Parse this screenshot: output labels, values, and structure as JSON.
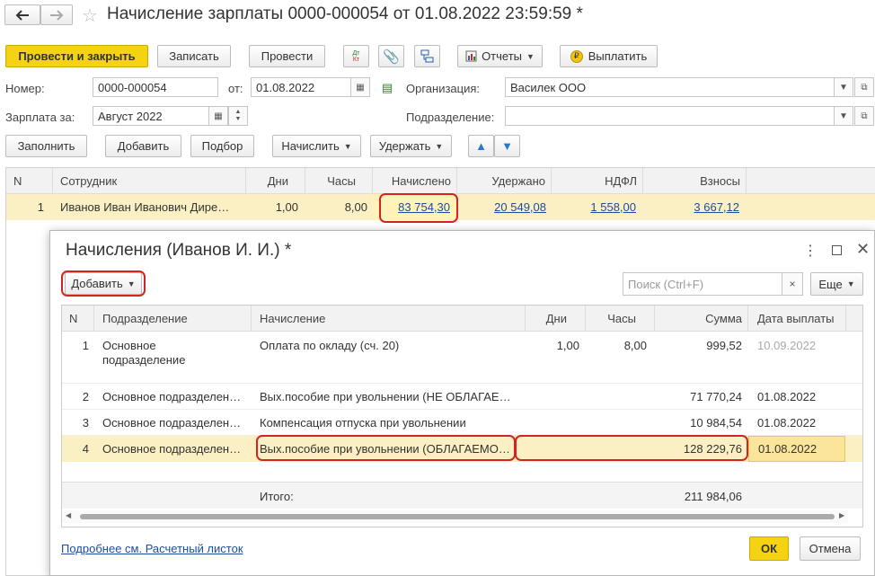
{
  "window": {
    "title": "Начисление зарплаты 0000-000054 от 01.08.2022 23:59:59 *"
  },
  "toolbar": {
    "post_close": "Провести и закрыть",
    "save": "Записать",
    "post": "Провести",
    "reports": "Отчеты",
    "pay": "Выплатить",
    "dtkt": "Дт Кт"
  },
  "header": {
    "number_label": "Номер:",
    "number": "0000-000054",
    "date_label": "от:",
    "date": "01.08.2022",
    "org_label": "Организация:",
    "org": "Василек ООО",
    "salary_for_label": "Зарплата за:",
    "salary_for": "Август 2022",
    "dept_label": "Подразделение:",
    "dept": ""
  },
  "actions": {
    "fill": "Заполнить",
    "add": "Добавить",
    "select": "Подбор",
    "accrue": "Начислить",
    "withhold": "Удержать"
  },
  "main_table": {
    "columns": [
      "N",
      "Сотрудник",
      "Дни",
      "Часы",
      "Начислено",
      "Удержано",
      "НДФЛ",
      "Взносы"
    ],
    "rows": [
      {
        "n": "1",
        "employee": "Иванов Иван Иванович Дире…",
        "days": "1,00",
        "hours": "8,00",
        "accrued": "83 754,30",
        "withheld": "20 549,08",
        "ndfl": "1 558,00",
        "contrib": "3 667,12"
      }
    ]
  },
  "dialog": {
    "title": "Начисления (Иванов И. И.) *",
    "add": "Добавить",
    "search_placeholder": "Поиск (Ctrl+F)",
    "more": "Еще",
    "columns": [
      "N",
      "Подразделение",
      "Начисление",
      "Дни",
      "Часы",
      "Сумма",
      "Дата выплаты"
    ],
    "rows": [
      {
        "n": "1",
        "dept": "Основное",
        "dept2": "подразделение",
        "accrual": "Оплата по окладу (сч. 20)",
        "days": "1,00",
        "hours": "8,00",
        "sum": "999,52",
        "date": "10.09.2022"
      },
      {
        "n": "2",
        "dept": "Основное подразделен…",
        "accrual": "Вых.пособие при увольнении (НЕ ОБЛАГАЕ…",
        "days": "",
        "hours": "",
        "sum": "71 770,24",
        "date": "01.08.2022"
      },
      {
        "n": "3",
        "dept": "Основное подразделен…",
        "accrual": "Компенсация отпуска при увольнении",
        "days": "",
        "hours": "",
        "sum": "10 984,54",
        "date": "01.08.2022"
      },
      {
        "n": "4",
        "dept": "Основное подразделен…",
        "accrual": "Вых.пособие при увольнении (ОБЛАГАЕМО…",
        "days": "",
        "hours": "",
        "sum": "128 229,76",
        "date": "01.08.2022"
      }
    ],
    "total_label": "Итого:",
    "total": "211 984,06",
    "footer_link": "Подробнее см. Расчетный листок",
    "ok": "ОК",
    "cancel": "Отмена"
  },
  "colors": {
    "accent_yellow": "#f5d312",
    "highlight": "#d42323",
    "selected_row": "#fbf0c4"
  }
}
